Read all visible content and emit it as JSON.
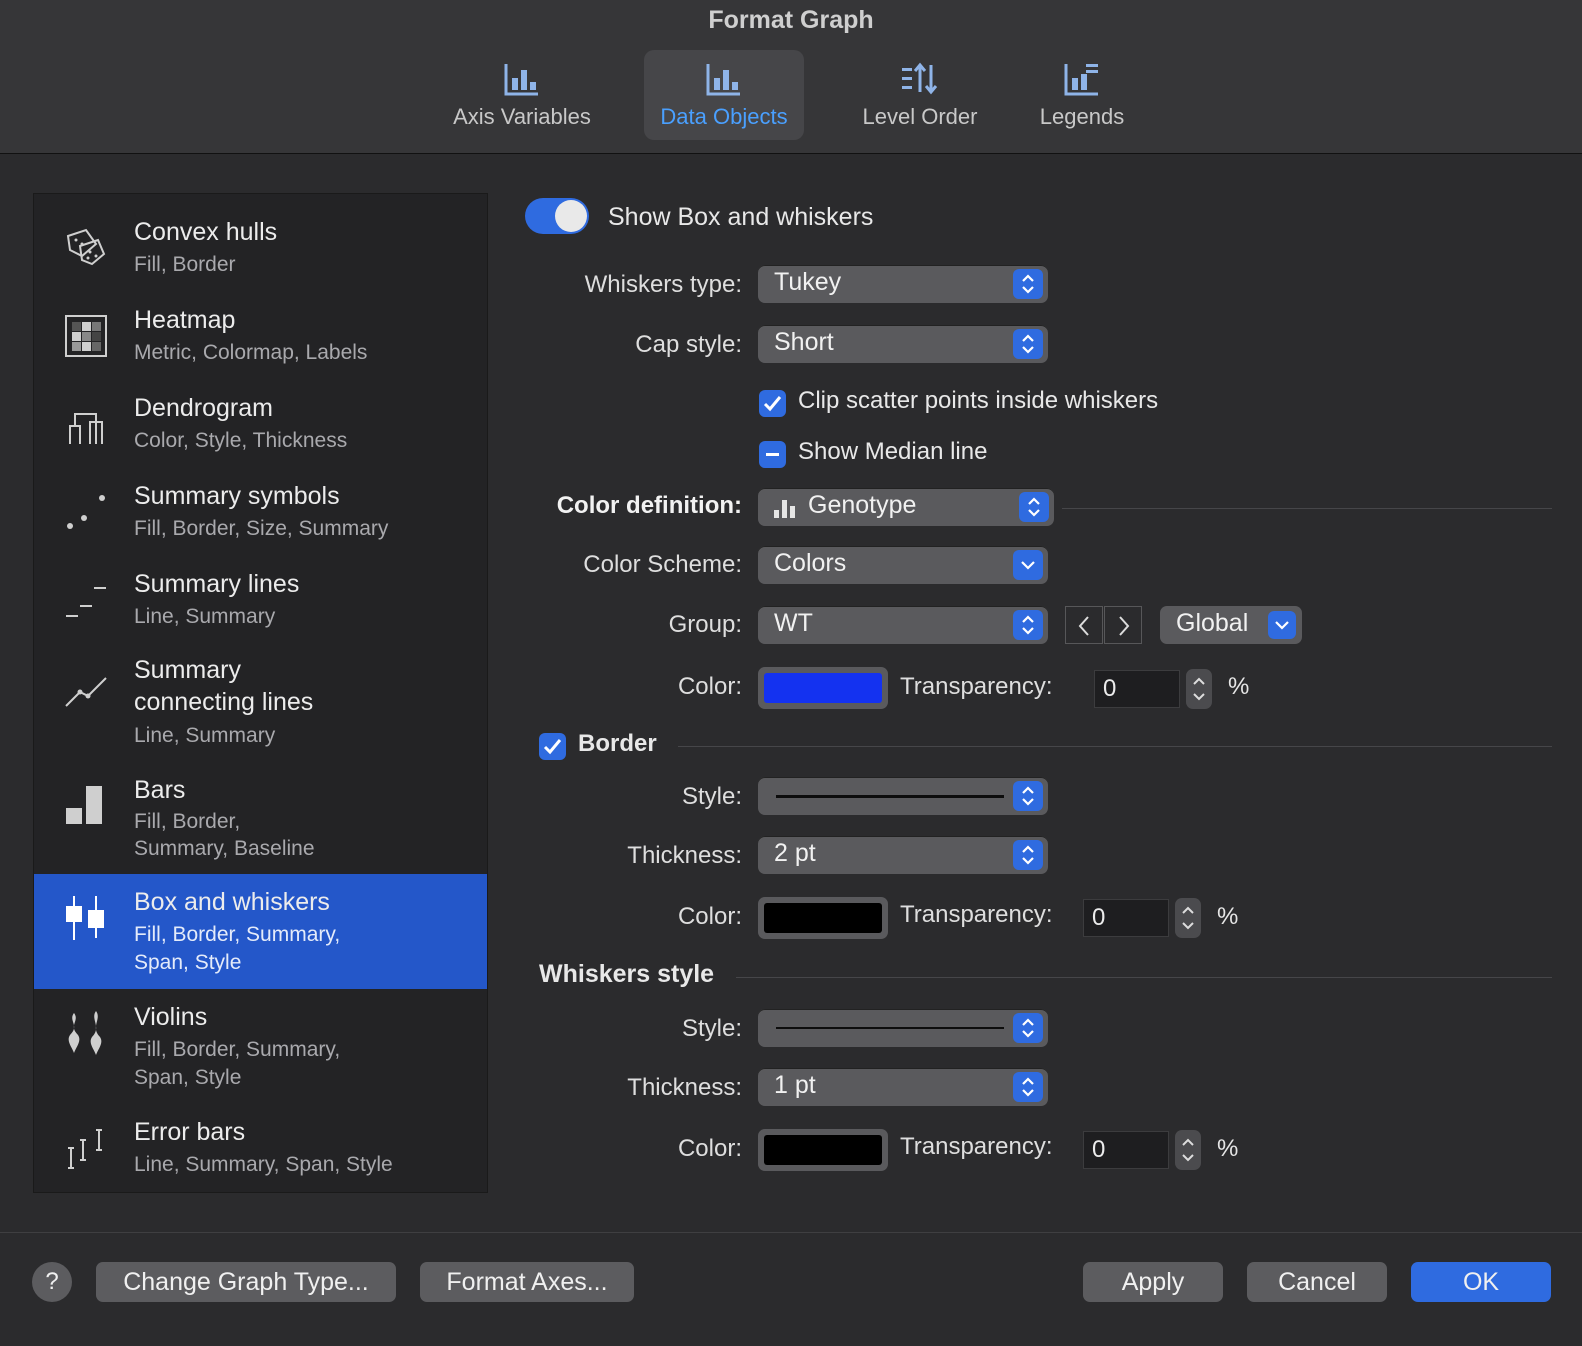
{
  "window": {
    "title": "Format Graph"
  },
  "tabs": [
    {
      "label": "Axis Variables",
      "icon": "axis-variables-icon"
    },
    {
      "label": "Data Objects",
      "icon": "data-objects-icon",
      "active": true
    },
    {
      "label": "Level Order",
      "icon": "level-order-icon"
    },
    {
      "label": "Legends",
      "icon": "legends-icon"
    }
  ],
  "list": {
    "items": [
      {
        "title": "Convex hulls",
        "sub": "Fill, Border",
        "icon": "convex-hulls-icon"
      },
      {
        "title": "Heatmap",
        "sub": "Metric, Colormap, Labels",
        "icon": "heatmap-icon"
      },
      {
        "title": "Dendrogram",
        "sub": "Color, Style, Thickness",
        "icon": "dendrogram-icon"
      },
      {
        "title": "Summary symbols",
        "sub": "Fill, Border, Size, Summary",
        "icon": "summary-symbols-icon"
      },
      {
        "title": "Summary lines",
        "sub": "Line, Summary",
        "icon": "summary-lines-icon"
      },
      {
        "title": "Summary",
        "title2": "connecting lines",
        "sub": "Line, Summary",
        "icon": "summary-connecting-lines-icon"
      },
      {
        "title": "Bars",
        "sub": "Fill, Border,",
        "sub2": "Summary, Baseline",
        "icon": "bars-icon"
      },
      {
        "title": "Box and whiskers",
        "sub": "Fill, Border, Summary,",
        "sub2": "Span, Style",
        "icon": "box-whiskers-icon",
        "selected": true
      },
      {
        "title": "Violins",
        "sub": "Fill, Border, Summary,",
        "sub2": "Span, Style",
        "icon": "violins-icon"
      },
      {
        "title": "Error bars",
        "sub": "Line, Summary, Span, Style",
        "icon": "error-bars-icon"
      }
    ]
  },
  "panel": {
    "show_toggle_label": "Show Box and whiskers",
    "show_toggle_on": true,
    "whiskers_type_label": "Whiskers type:",
    "whiskers_type_value": "Tukey",
    "cap_style_label": "Cap style:",
    "cap_style_value": "Short",
    "clip_label": "Clip scatter points inside whiskers",
    "clip_checked": true,
    "median_label": "Show Median line",
    "median_state": "mixed",
    "color_definition_label": "Color definition:",
    "color_definition_value": "Genotype",
    "color_scheme_label": "Color Scheme:",
    "color_scheme_value": "Colors",
    "group_label": "Group:",
    "group_value": "WT",
    "global_value": "Global",
    "color_label": "Color:",
    "fill_color": "#1432f0",
    "transparency_label": "Transparency:",
    "fill_transparency": "0",
    "percent": "%",
    "border_label": "Border",
    "border_checked": true,
    "border_style_label": "Style:",
    "border_thickness_label": "Thickness:",
    "border_thickness_value": "2 pt",
    "border_color_label": "Color:",
    "border_color": "#000000",
    "border_transparency_label": "Transparency:",
    "border_transparency": "0",
    "whiskers_style_heading": "Whiskers style",
    "whiskers_style_label": "Style:",
    "whiskers_thickness_label": "Thickness:",
    "whiskers_thickness_value": "1 pt",
    "whiskers_color_label": "Color:",
    "whiskers_color": "#000000",
    "whiskers_transparency_label": "Transparency:",
    "whiskers_transparency": "0"
  },
  "footer": {
    "help": "?",
    "change_graph_type": "Change Graph Type...",
    "format_axes": "Format Axes...",
    "apply": "Apply",
    "cancel": "Cancel",
    "ok": "OK"
  },
  "colors": {
    "accent": "#2f6be0",
    "selection": "#2457c9",
    "tab_active_text": "#4aa0ff"
  }
}
